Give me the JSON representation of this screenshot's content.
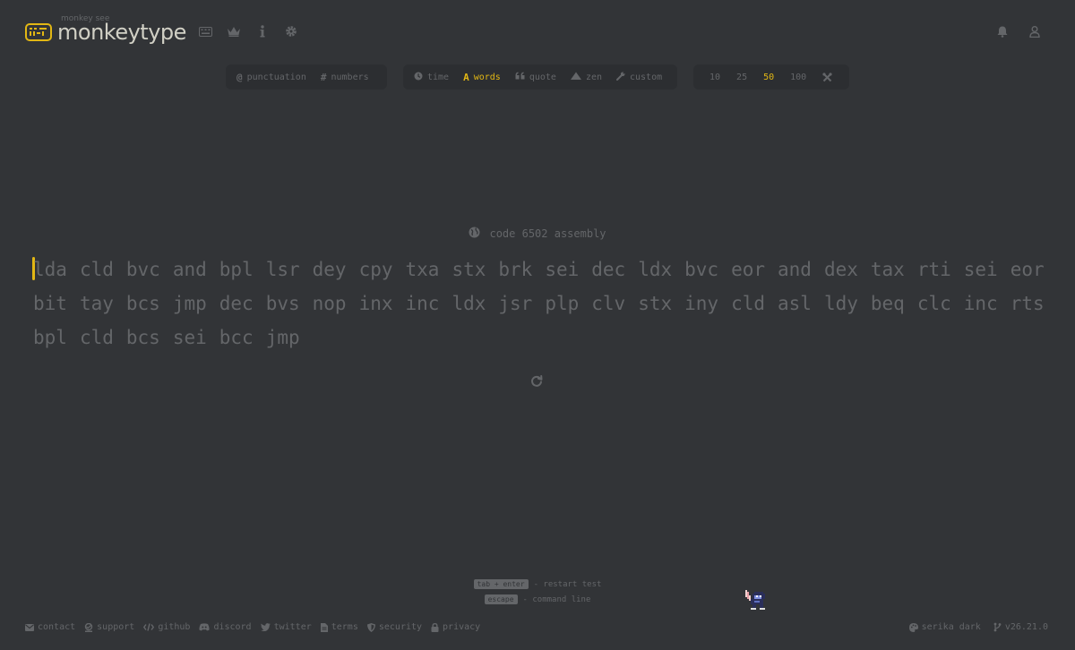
{
  "brand": {
    "tagline": "monkey see",
    "name": "monkeytype",
    "accent": "#e2b714",
    "background": "#323437",
    "text_sub": "#646669",
    "text_main": "#d1d0c5"
  },
  "nav": {
    "icons": [
      "keyboard-icon",
      "crown-icon",
      "info-icon",
      "gear-icon"
    ],
    "right_icons": [
      "bell-icon",
      "user-icon"
    ]
  },
  "config": {
    "toggles": [
      {
        "icon": "@",
        "label": "punctuation"
      },
      {
        "icon": "#",
        "label": "numbers"
      }
    ],
    "modes": [
      {
        "icon": "clock-icon",
        "label": "time",
        "active": false
      },
      {
        "icon": "A",
        "label": "words",
        "active": true
      },
      {
        "icon": "quote-icon",
        "label": "quote",
        "active": false
      },
      {
        "icon": "mountain-icon",
        "label": "zen",
        "active": false
      },
      {
        "icon": "wrench-icon",
        "label": "custom",
        "active": false
      }
    ],
    "counts": [
      {
        "label": "10",
        "active": false
      },
      {
        "label": "25",
        "active": false
      },
      {
        "label": "50",
        "active": true
      },
      {
        "label": "100",
        "active": false
      }
    ]
  },
  "test": {
    "language": "code 6502 assembly",
    "words": [
      "lda",
      "cld",
      "bvc",
      "and",
      "bpl",
      "lsr",
      "dey",
      "cpy",
      "txa",
      "stx",
      "brk",
      "sei",
      "dec",
      "ldx",
      "bvc",
      "eor",
      "and",
      "dex",
      "tax",
      "rti",
      "sei",
      "eor",
      "bit",
      "tay",
      "bcs",
      "jmp",
      "dec",
      "bvs",
      "nop",
      "inx",
      "inc",
      "ldx",
      "jsr",
      "plp",
      "clv",
      "stx",
      "iny",
      "cld",
      "asl",
      "ldy",
      "beq",
      "clc",
      "inc",
      "rts",
      "bpl",
      "cld",
      "bcs",
      "sei",
      "bcc",
      "jmp"
    ]
  },
  "hints": {
    "restart_keys": "tab + enter",
    "restart_text": "- restart test",
    "command_key": "escape",
    "command_text": "- command line"
  },
  "footer": {
    "links": [
      {
        "icon": "envelope-icon",
        "label": "contact"
      },
      {
        "icon": "donate-icon",
        "label": "support"
      },
      {
        "icon": "code-icon",
        "label": "github"
      },
      {
        "icon": "discord-icon",
        "label": "discord"
      },
      {
        "icon": "twitter-icon",
        "label": "twitter"
      },
      {
        "icon": "document-icon",
        "label": "terms"
      },
      {
        "icon": "shield-icon",
        "label": "security"
      },
      {
        "icon": "lock-icon",
        "label": "privacy"
      }
    ],
    "theme": "serika dark",
    "version": "v26.21.0"
  }
}
